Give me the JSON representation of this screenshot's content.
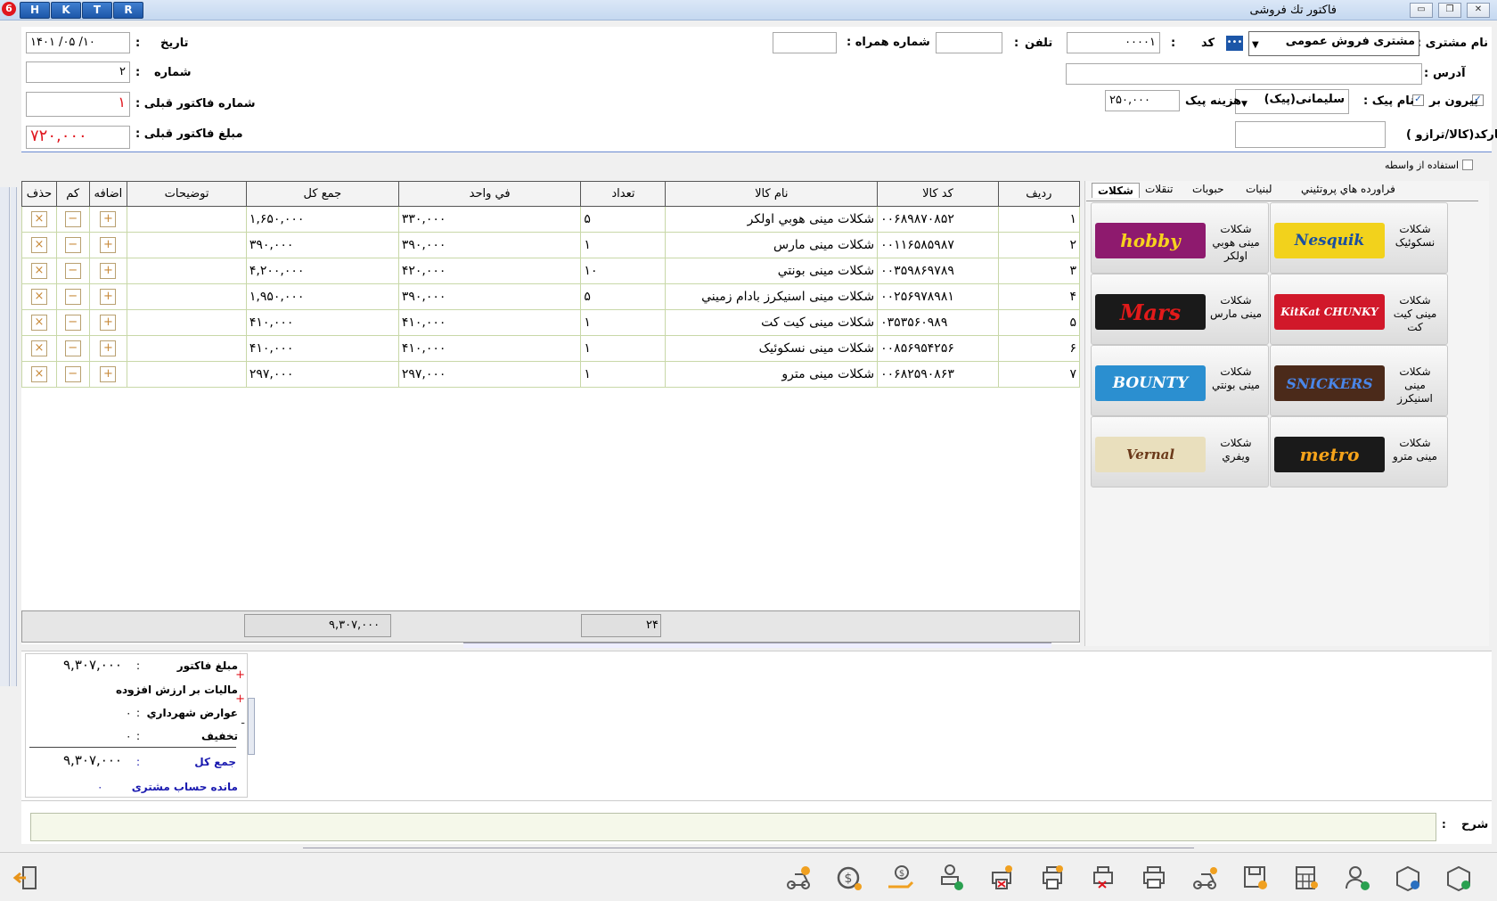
{
  "window": {
    "title": "فاکتور تك فروشی",
    "app_buttons": [
      "H",
      "K",
      "T",
      "R"
    ]
  },
  "header": {
    "customer_name_label": "نام مشتری :",
    "customer_name_value": "مشتری فروش عمومی",
    "code_label": "کد",
    "code_sep": ":",
    "code_value": "۰۰۰۰۱",
    "phone_label": "تلفن",
    "phone_sep": ":",
    "mobile_label": "شماره همراه :",
    "date_label": "تاریخ",
    "date_sep": ":",
    "date_value": "۱۴۰۱  /۰۵  /۱۰",
    "number_label": "شماره",
    "number_sep": ":",
    "number_value": "۲",
    "address_label": "آدرس",
    "address_sep": ":",
    "prev_invoice_no_label": "شماره فاکتور قبلی :",
    "prev_invoice_no_value": "۱",
    "prev_invoice_amount_label": "مبلغ فاکتور قبلی :",
    "prev_invoice_amount_value": "۷۲۰,۰۰۰",
    "takeout_label": "بیرون بر",
    "courier_label": "نام پیک :",
    "courier_value": "سلیمانی(پیک)",
    "courier_cost_label": "هزینه پیک",
    "courier_cost_value": "۲۵۰,۰۰۰",
    "barcode_label": "بارکد(کالا/ترازو )",
    "intermediary_label": "استفاده از واسطه"
  },
  "grid": {
    "columns": [
      "ردیف",
      "کد کالا",
      "نام کالا",
      "تعداد",
      "في واحد",
      "جمع کل",
      "توضيحات",
      "اضافه",
      "کم",
      "حذف"
    ],
    "rows": [
      {
        "row": "۱",
        "code": "۰۰۶۸۹۸۷۰۸۵۲",
        "name": "شكلات مینی هوبي اولکر",
        "qty": "۵",
        "unit": "۳۳۰,۰۰۰",
        "total": "۱,۶۵۰,۰۰۰"
      },
      {
        "row": "۲",
        "code": "۰۰۱۱۶۵۸۵۹۸۷",
        "name": "شكلات مینی مارس",
        "qty": "۱",
        "unit": "۳۹۰,۰۰۰",
        "total": "۳۹۰,۰۰۰"
      },
      {
        "row": "۳",
        "code": "۰۰۳۵۹۸۶۹۷۸۹",
        "name": "شكلات مینی بونتي",
        "qty": "۱۰",
        "unit": "۴۲۰,۰۰۰",
        "total": "۴,۲۰۰,۰۰۰"
      },
      {
        "row": "۴",
        "code": "۰۰۲۵۶۹۷۸۹۸۱",
        "name": "شكلات مینی اسنيكرز بادام زميني",
        "qty": "۵",
        "unit": "۳۹۰,۰۰۰",
        "total": "۱,۹۵۰,۰۰۰"
      },
      {
        "row": "۵",
        "code": "۰۳۵۳۵۶۰۹۸۹",
        "name": "شكلات مینی كيت كت",
        "qty": "۱",
        "unit": "۴۱۰,۰۰۰",
        "total": "۴۱۰,۰۰۰"
      },
      {
        "row": "۶",
        "code": "۰۰۸۵۶۹۵۴۲۵۶",
        "name": "شكلات مینی نسكوئيک",
        "qty": "۱",
        "unit": "۴۱۰,۰۰۰",
        "total": "۴۱۰,۰۰۰"
      },
      {
        "row": "۷",
        "code": "۰۰۶۸۲۵۹۰۸۶۳",
        "name": "شكلات مینی مترو",
        "qty": "۱",
        "unit": "۲۹۷,۰۰۰",
        "total": "۲۹۷,۰۰۰"
      }
    ],
    "footer_total": "۹,۳۰۷,۰۰۰",
    "footer_qty": "۲۴"
  },
  "categories": {
    "tabs": [
      "شكلات",
      "تنقلات",
      "حبوبات",
      "لبنيات",
      "فراورده هاي پروتئيني"
    ],
    "products": [
      {
        "name": "شكلات نسكوئیک",
        "brand": "Nesquik",
        "color": "#f2d21c",
        "text": "#1a4fa0"
      },
      {
        "name": "شكلات مینی هوبي اولکر",
        "brand": "hobby",
        "color": "#8e1a6e",
        "text": "#f7d21e"
      },
      {
        "name": "شكلات مینی كيت كت",
        "brand": "KitKat CHUNKY",
        "color": "#d1182a",
        "text": "#ffffff"
      },
      {
        "name": "شكلات مینی مارس",
        "brand": "Mars",
        "color": "#1a1a1a",
        "text": "#e21a1a"
      },
      {
        "name": "شكلات مینی اسنيكرز",
        "brand": "SNICKERS",
        "color": "#4b2a1a",
        "text": "#1f4fa8"
      },
      {
        "name": "شكلات مینی بونتي",
        "brand": "BOUNTY",
        "color": "#2b8fd0",
        "text": "#ffffff"
      },
      {
        "name": "شكلات مینی مترو",
        "brand": "metro",
        "color": "#1a1a1a",
        "text": "#f5a31a"
      },
      {
        "name": "شكلات ویفري",
        "brand": "Vernal",
        "color": "#e9dfbd",
        "text": "#6b3a1a"
      }
    ]
  },
  "summary": {
    "invoice_amount_label": "مبلغ فاكتور",
    "invoice_amount_value": "۹,۳۰۷,۰۰۰",
    "vat_label": "ماليات بر ارزش افزوده",
    "vat_value": "۰",
    "municipal_label": "عوارض شهرداري",
    "municipal_value": "۰",
    "discount_label": "تخفيف",
    "discount_value": "۰",
    "grand_total_label": "جمع کل",
    "grand_total_value": "۹,۳۰۷,۰۰۰",
    "balance_label": "مانده حساب مشتری",
    "balance_value": "۰",
    "colon": ":",
    "plus": "+",
    "minus": "-"
  },
  "description": {
    "label": "شرح",
    "sep": ":"
  },
  "colors": {
    "accent": "#1c56a8",
    "red": "#e0161e",
    "blue_text": "#1a1ab0",
    "grid_border": "#c8d8a8"
  }
}
